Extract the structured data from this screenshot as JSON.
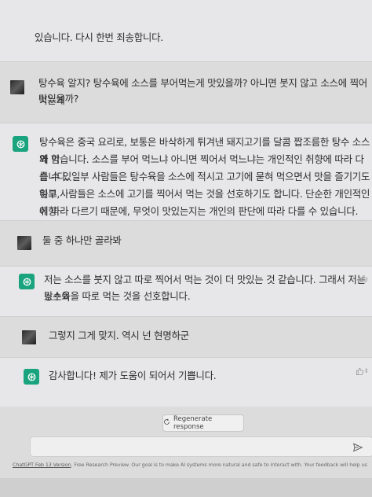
{
  "messages": [
    {
      "role": "assistant",
      "text": "있습니다. 다시 한번 죄송합니다."
    },
    {
      "role": "user",
      "lines": [
        "탕수육 알지? 탕수육에 소스를 부어먹는게 맛있을까? 아니면 붓지 않고 소스에 찍어먹는게",
        "맛있을까?"
      ]
    },
    {
      "role": "assistant",
      "lines": [
        "탕수육은 중국 요리로, 보통은 바삭하게 튀겨낸 돼지고기를 달콤 짭조름한 탕수 소스와 함",
        "께 먹습니다. 소스를 부어 먹느냐 아니면 찍어서 먹느냐는 개인적인 취향에 따라 다를 수 있",
        "습니다. 일부 사람들은 탕수육을 소스에 적시고 고기에 묻혀 먹으면서 맛을 즐기기도 하고,",
        "일부 사람들은 소스에 고기를 찍어서 먹는 것을 선호하기도 합니다. 단순한 개인적인 취향",
        "에 따라 다르기 때문에, 무엇이 맛있는지는 개인의 판단에 따라 다를 수 있습니다."
      ]
    },
    {
      "role": "user",
      "text": "둘 중 하나만 골라봐"
    },
    {
      "role": "assistant",
      "lines": [
        "저는 소스를 붓지 않고 따로 찍어서 먹는 것이 더 맛있는 것 같습니다. 그래서 저는 소스와",
        "탕수육을 따로 먹는 것을 선호합니다."
      ]
    },
    {
      "role": "user",
      "text": "그렇지 그게 맞지. 역시 넌 현명하군"
    },
    {
      "role": "assistant",
      "text": "감사합니다! 제가 도움이 되어서 기쁩니다."
    }
  ],
  "regenerate_label": "Regenerate response",
  "footer": {
    "link": "ChatGPT Feb 13 Version",
    "text": ". Free Research Preview. Our goal is to make AI systems more natural and safe to interact with. Your feedback will help us"
  },
  "icons": {
    "user_avatar": "user-avatar",
    "assistant_avatar": "openai-logo-icon",
    "regen": "refresh-icon",
    "send": "send-icon",
    "thumb": "thumbs-up-icon"
  },
  "colors": {
    "assistant_bg": "#e7e7e9",
    "user_bg": "#dcdcdc",
    "gpt_green": "#19a37e"
  }
}
